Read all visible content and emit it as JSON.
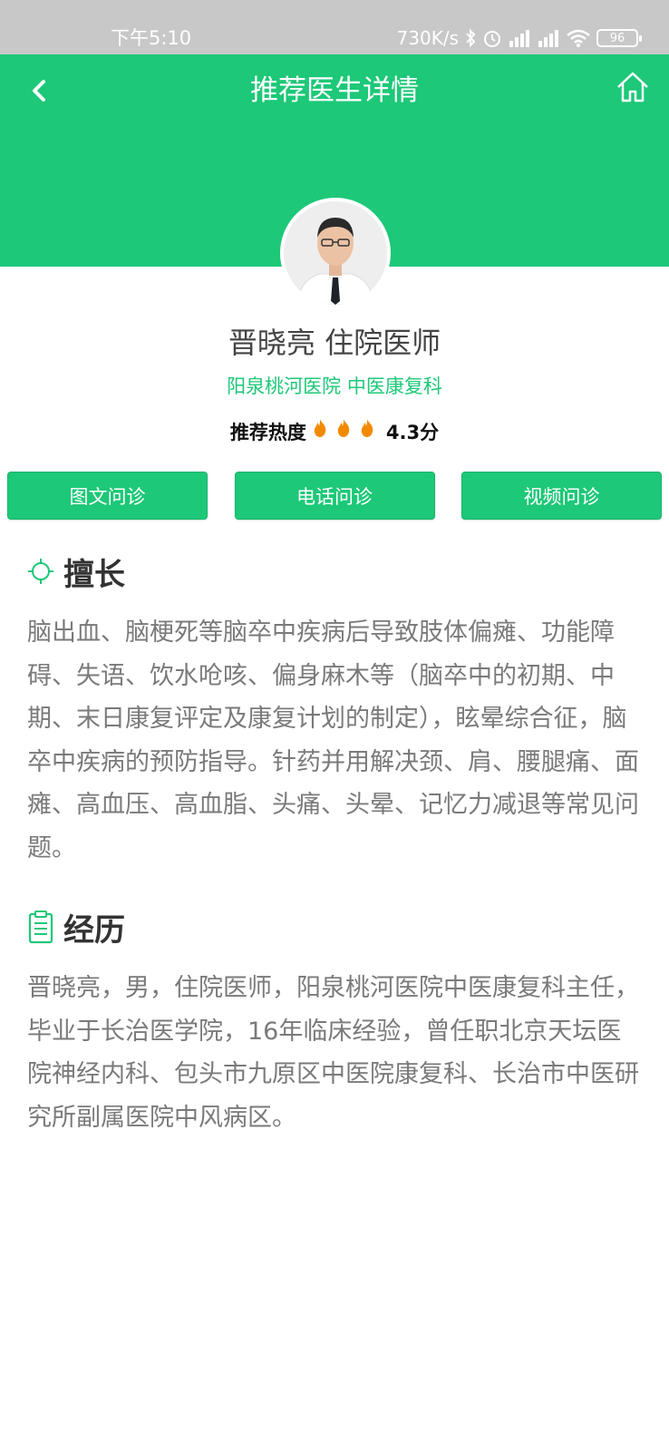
{
  "status": {
    "time": "下午5:10",
    "speed": "730K/s",
    "battery": "96"
  },
  "header": {
    "title": "推荐医生详情"
  },
  "doctor": {
    "name": "晋晓亮 住院医师",
    "hospital": "阳泉桃河医院 中医康复科",
    "heat_label": "推荐热度",
    "flames": 3,
    "score": "4.3分"
  },
  "consult": {
    "buttons": [
      "图文问诊",
      "电话问诊",
      "视频问诊"
    ]
  },
  "specialty": {
    "title": "擅长",
    "text": "脑出血、脑梗死等脑卒中疾病后导致肢体偏瘫、功能障碍、失语、饮水呛咳、偏身麻木等（脑卒中的初期、中期、末日康复评定及康复计划的制定），眩晕综合征，脑卒中疾病的预防指导。针药并用解决颈、肩、腰腿痛、面瘫、高血压、高血脂、头痛、头晕、记忆力减退等常见问题。"
  },
  "experience": {
    "title": "经历",
    "text": "晋晓亮，男，住院医师，阳泉桃河医院中医康复科主任，毕业于长治医学院，16年临床经验，曾任职北京天坛医院神经内科、包头市九原区中医院康复科、长治市中医研究所副属医院中风病区。"
  },
  "colors": {
    "brand_green": "#1dc878",
    "flame_orange": "#f28a00"
  },
  "icons": {
    "back": "chevron-left-icon",
    "home": "home-icon",
    "specialty": "crosshair-icon",
    "experience": "clipboard-icon"
  }
}
